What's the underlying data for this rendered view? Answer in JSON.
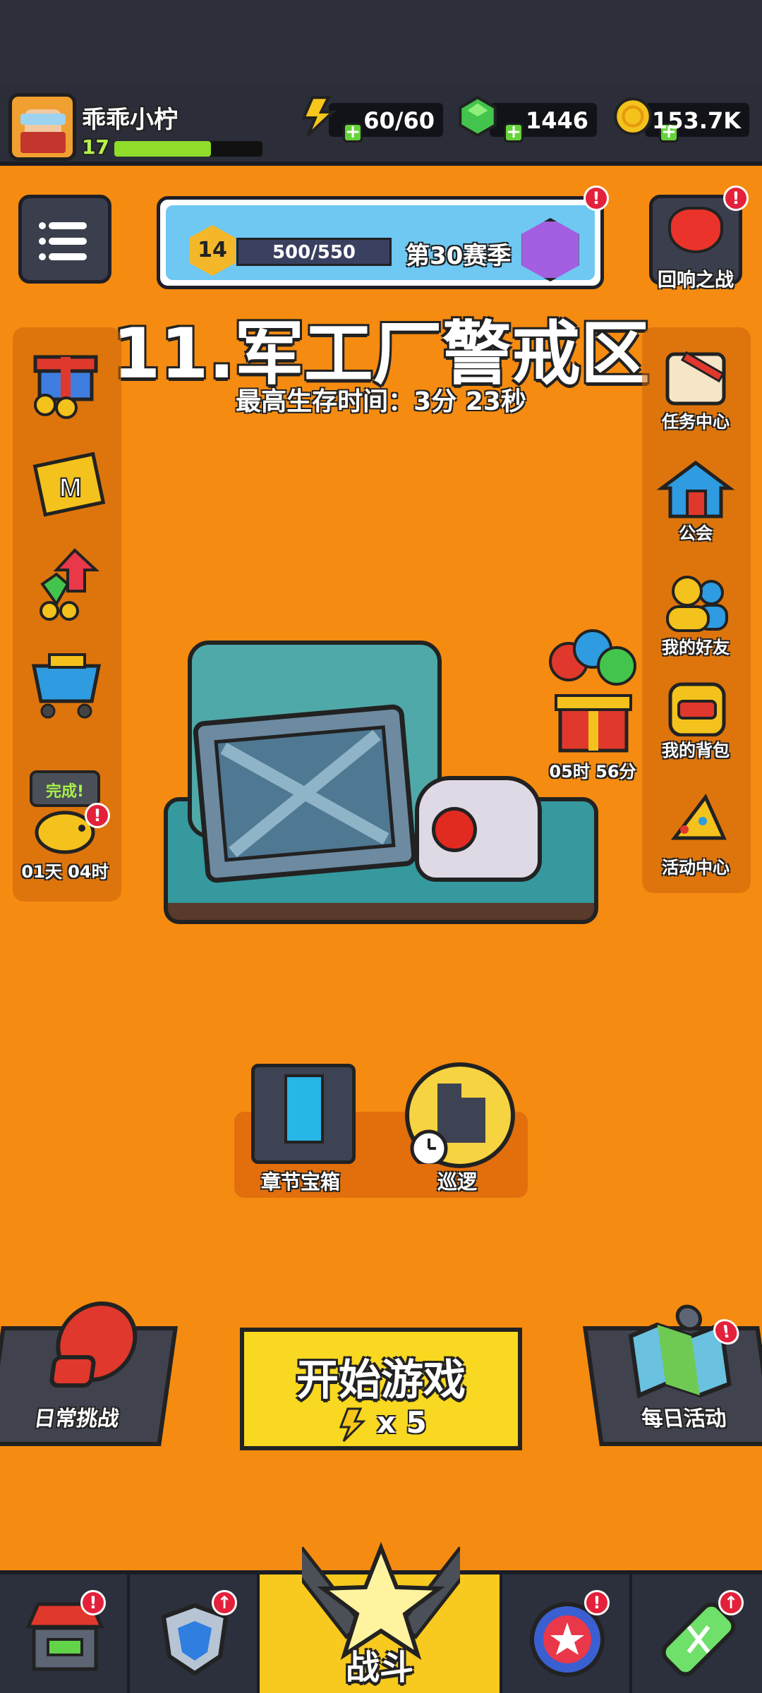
{
  "player": {
    "name": "乖乖小柠",
    "level": "17",
    "xp_fraction": 0.65
  },
  "resources": [
    {
      "name": "energy",
      "value": "60/60",
      "icon": "lightning-icon",
      "color": "#f7c61b"
    },
    {
      "name": "gems",
      "value": "1446",
      "icon": "gem-icon",
      "color": "#43c44c"
    },
    {
      "name": "coins",
      "value": "153.7K",
      "icon": "coin-icon",
      "color": "#f4c21c"
    }
  ],
  "season": {
    "level": "14",
    "progress": "500/550",
    "title": "第30赛季",
    "badge_color": "#a45ee0"
  },
  "echo_battle": {
    "label": "回响之战"
  },
  "stage": {
    "title": "11.军工厂警戒区",
    "best_time": "最高生存时间：3分 23秒"
  },
  "left_panel": {
    "items": [
      {
        "name": "gift",
        "icon": "gift-icon"
      },
      {
        "name": "monthly-card",
        "icon": "card-icon"
      },
      {
        "name": "growth",
        "icon": "growth-icon"
      },
      {
        "name": "shop-cart",
        "icon": "cart-icon"
      },
      {
        "name": "piggy-bank",
        "icon": "piggy-icon",
        "bubble": "完成!",
        "timer": "01天 04时"
      }
    ]
  },
  "right_panel": {
    "items": [
      {
        "name": "tasks",
        "label": "任务中心",
        "icon": "scroll-icon"
      },
      {
        "name": "guild",
        "label": "公会",
        "icon": "house-icon"
      },
      {
        "name": "friends",
        "label": "我的好友",
        "icon": "friends-icon"
      },
      {
        "name": "backpack",
        "label": "我的背包",
        "icon": "backpack-icon"
      },
      {
        "name": "events",
        "label": "活动中心",
        "icon": "party-icon"
      }
    ]
  },
  "balloon_gift": {
    "timer": "05时 56分"
  },
  "middle": {
    "chest_label": "章节宝箱",
    "patrol_label": "巡逻"
  },
  "bottom": {
    "daily_challenge": "日常挑战",
    "start_title": "开始游戏",
    "start_cost": "x 5",
    "daily_activity": "每日活动"
  },
  "tabs": [
    {
      "name": "shop",
      "icon": "shop-icon",
      "badge": "!"
    },
    {
      "name": "equipment",
      "icon": "shield-icon",
      "badge": "↑"
    },
    {
      "name": "battle",
      "label": "战斗",
      "icon": "battle-star-icon"
    },
    {
      "name": "pets",
      "icon": "star-ball-icon",
      "badge": "!"
    },
    {
      "name": "talent",
      "icon": "dna-icon",
      "badge": "↑"
    }
  ]
}
